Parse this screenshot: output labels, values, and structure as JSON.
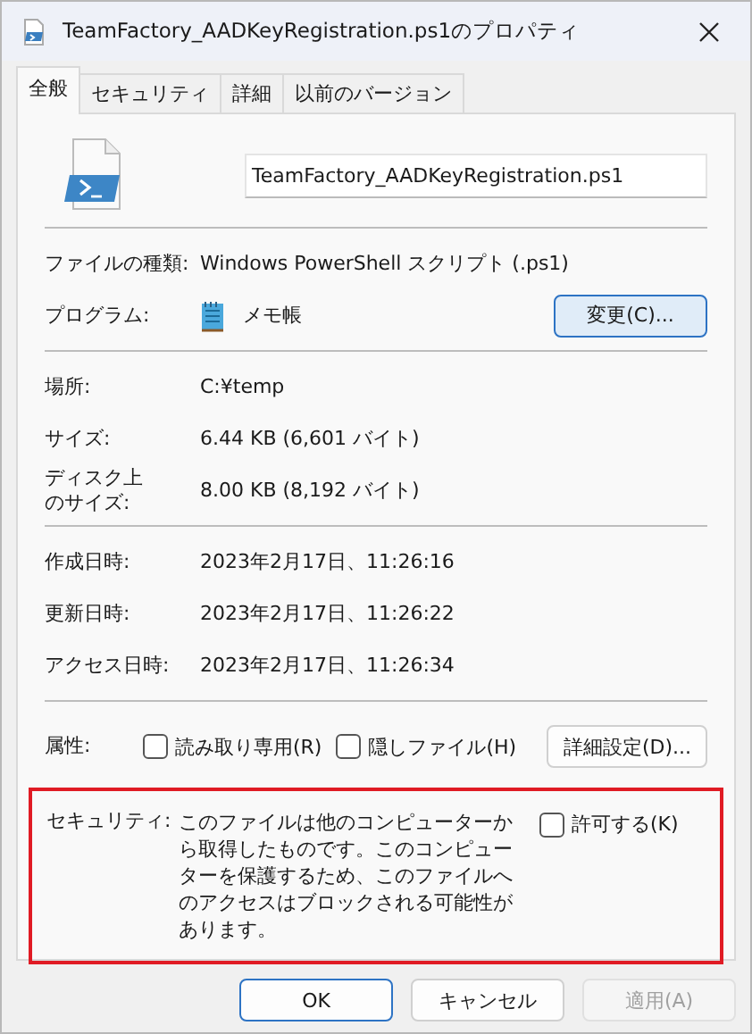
{
  "window": {
    "title": "TeamFactory_AADKeyRegistration.ps1のプロパティ"
  },
  "tabs": [
    {
      "label": "全般",
      "selected": true
    },
    {
      "label": "セキュリティ",
      "selected": false
    },
    {
      "label": "詳細",
      "selected": false
    },
    {
      "label": "以前のバージョン",
      "selected": false
    }
  ],
  "file_name": "TeamFactory_AADKeyRegistration.ps1",
  "groups": [
    [
      {
        "kind": "text",
        "label": "ファイルの種類:",
        "value": "Windows PowerShell スクリプト (.ps1)"
      },
      {
        "kind": "program",
        "label": "プログラム:",
        "value": "メモ帳",
        "button": "変更(C)..."
      }
    ],
    [
      {
        "kind": "text",
        "label": "場所:",
        "value": "C:¥temp"
      },
      {
        "kind": "text",
        "label": "サイズ:",
        "value": "6.44 KB (6,601 バイト)"
      },
      {
        "kind": "wrapped",
        "label": "ディスク上のサイズ:",
        "value": "8.00 KB (8,192 バイト)"
      }
    ],
    [
      {
        "kind": "text",
        "label": "作成日時:",
        "value": "2023年2月17日、11:26:16"
      },
      {
        "kind": "text",
        "label": "更新日時:",
        "value": "2023年2月17日、11:26:22"
      },
      {
        "kind": "text",
        "label": "アクセス日時:",
        "value": "2023年2月17日、11:26:34"
      }
    ]
  ],
  "attributes": {
    "label": "属性:",
    "options": [
      {
        "label": "読み取り専用(R)",
        "checked": false
      },
      {
        "label": "隠しファイル(H)",
        "checked": false
      }
    ],
    "button": "詳細設定(D)..."
  },
  "security": {
    "label": "セキュリティ:",
    "text": "このファイルは他のコンピューターから取得したものです。このコンピューターを保護するため、このファイルへのアクセスはブロックされる可能性があります。",
    "option": {
      "label": "許可する(K)",
      "checked": false
    },
    "highlighted": true
  },
  "buttons": [
    {
      "label": "OK",
      "default": true,
      "disabled": false
    },
    {
      "label": "キャンセル",
      "default": false,
      "disabled": false
    },
    {
      "label": "適用(A)",
      "default": false,
      "disabled": true
    }
  ]
}
